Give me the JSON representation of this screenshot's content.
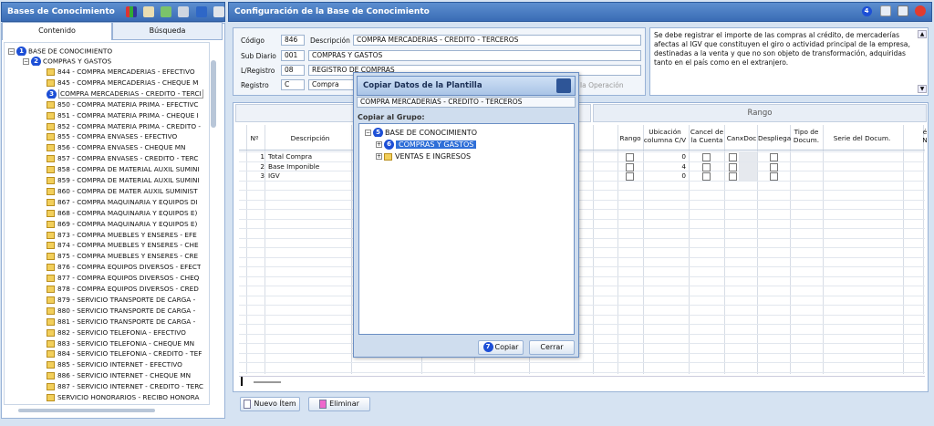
{
  "left_panel": {
    "title": "Bases de Conocimiento",
    "tabs": [
      "Contenido",
      "Búsqueda"
    ],
    "tree": {
      "root": {
        "badge": "1",
        "label": "BASE DE CONOCIMIENTO"
      },
      "group": {
        "badge": "2",
        "label": "COMPRAS Y GASTOS"
      },
      "items": [
        {
          "label": "844 - COMPRA MERCADERIAS - EFECTIVO"
        },
        {
          "label": "845 - COMPRA MERCADERIAS - CHEQUE M"
        },
        {
          "label": "COMPRA MERCADERIAS - CREDITO - TERCI",
          "badge": "3"
        },
        {
          "label": "850 - COMPRA MATERIA PRIMA - EFECTIVC"
        },
        {
          "label": "851 - COMPRA MATERIA PRIMA - CHEQUE I"
        },
        {
          "label": "852 - COMPRA MATERIA PRIMA - CREDITO -"
        },
        {
          "label": "855 - COMPRA ENVASES - EFECTIVO"
        },
        {
          "label": "856 - COMPRA ENVASES - CHEQUE MN"
        },
        {
          "label": "857 - COMPRA ENVASES - CREDITO - TERC"
        },
        {
          "label": "858 - COMPRA DE MATERIAL AUXIL SUMINI"
        },
        {
          "label": "859 - COMPRA DE MATERIAL AUXIL SUMINI"
        },
        {
          "label": "860 - COMPRA DE MATER AUXIL SUMINIST"
        },
        {
          "label": "867 - COMPRA MAQUINARIA Y EQUIPOS DI"
        },
        {
          "label": "868 - COMPRA MAQUINARIA Y EQUIPOS E)"
        },
        {
          "label": "869 - COMPRA MAQUINARIA Y EQUIPOS E)"
        },
        {
          "label": "873 - COMPRA MUEBLES Y ENSERES - EFE"
        },
        {
          "label": "874 - COMPRA MUEBLES Y ENSERES - CHE"
        },
        {
          "label": "875 - COMPRA MUEBLES Y ENSERES - CRE"
        },
        {
          "label": "876 - COMPRA EQUIPOS DIVERSOS - EFECT"
        },
        {
          "label": "877 - COMPRA EQUIPOS DIVERSOS - CHEQ"
        },
        {
          "label": "878 - COMPRA EQUIPOS DIVERSOS - CRED"
        },
        {
          "label": "879 - SERVICIO TRANSPORTE DE CARGA -"
        },
        {
          "label": "880 - SERVICIO TRANSPORTE DE CARGA -"
        },
        {
          "label": "881 - SERVICIO TRANSPORTE DE CARGA -"
        },
        {
          "label": "882 - SERVICIO TELEFONIA - EFECTIVO"
        },
        {
          "label": "883 - SERVICIO TELEFONIA - CHEQUE MN"
        },
        {
          "label": "884 - SERVICIO TELEFONIA - CREDITO - TEF"
        },
        {
          "label": "885 - SERVICIO INTERNET - EFECTIVO"
        },
        {
          "label": "886 - SERVICIO INTERNET - CHEQUE MN"
        },
        {
          "label": "887 - SERVICIO INTERNET - CREDITO - TERC"
        },
        {
          "label": "SERVICIO HONORARIOS - RECIBO HONORA"
        }
      ]
    }
  },
  "right_panel": {
    "title": "Configuración de la Base de Conocimiento",
    "header_badge": "4",
    "fields": {
      "codigo_label": "Código",
      "codigo_value": "846",
      "descripcion_label": "Descripción",
      "descripcion_value": "COMPRA MERCADERIAS - CREDITO - TERCEROS",
      "subdiario_label": "Sub Diario",
      "subdiario_code": "001",
      "subdiario_value": "COMPRAS Y GASTOS",
      "lregistro_label": "L/Registro",
      "lregistro_code": "08",
      "lregistro_value": "REGISTRO DE COMPRAS",
      "registro_label": "Registro",
      "registro_code": "C",
      "registro_value": "Compra",
      "operacion_partial": "la Operación"
    },
    "note": "Se debe registrar el importe de las compras al crédito, de mercaderías afectas al IGV que constituyen el giro o actividad principal de la empresa, destinadas a la venta y que no son objeto de transformación, adquiridas tanto en el país como en el extranjero.",
    "rango_header": "Rango",
    "grid": {
      "columns": {
        "n": "Nº",
        "descripcion": "Descripción",
        "rango": "Rango",
        "ubicacion": "Ubicación columna C/V",
        "cancel": "Cancel de la Cuenta",
        "canxdoc": "CanxDoc",
        "despliega": "Despliega",
        "tipodoc": "Tipo de Docum.",
        "serie": "Serie del Docum.",
        "extra": "é N"
      },
      "rows": [
        {
          "n": "1",
          "desc": "Total Compra",
          "ubic": "0"
        },
        {
          "n": "2",
          "desc": "Base Imponible",
          "ubic": "4"
        },
        {
          "n": "3",
          "desc": "IGV",
          "ubic": "0"
        }
      ]
    },
    "buttons": {
      "nuevo": "Nuevo Ítem",
      "eliminar": "Eliminar"
    }
  },
  "dialog": {
    "title": "Copiar Datos de la Plantilla",
    "template_name": "COMPRA MERCADERIAS - CREDITO - TERCEROS",
    "copy_to_label": "Copiar al Grupo:",
    "tree_root": {
      "badge": "5",
      "label": "BASE DE CONOCIMIENTO"
    },
    "tree_children": [
      {
        "badge": "6",
        "label": "COMPRAS Y GASTOS",
        "selected": true
      },
      {
        "label": "VENTAS E INGRESOS",
        "selected": false
      }
    ],
    "copy_badge": "7",
    "copy_button": "Copiar",
    "close_button": "Cerrar"
  }
}
